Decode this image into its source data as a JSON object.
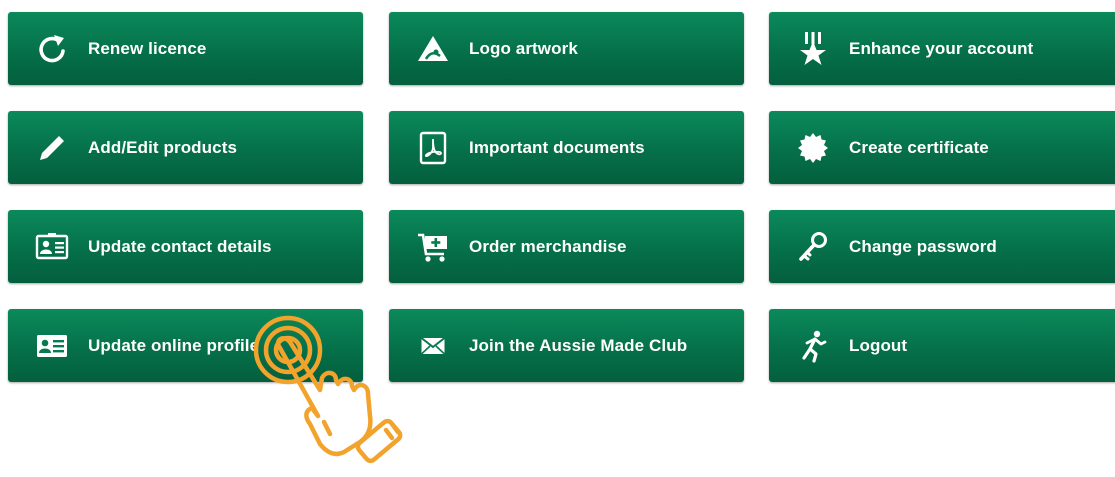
{
  "tiles": [
    {
      "label": "Renew licence",
      "icon": "refresh-icon"
    },
    {
      "label": "Logo artwork",
      "icon": "logo-mountain-icon"
    },
    {
      "label": "Enhance your account",
      "icon": "star-badge-icon"
    },
    {
      "label": "Add/Edit products",
      "icon": "pencil-icon"
    },
    {
      "label": "Important documents",
      "icon": "pdf-document-icon"
    },
    {
      "label": "Create certificate",
      "icon": "seal-icon"
    },
    {
      "label": "Update contact details",
      "icon": "contact-card-icon"
    },
    {
      "label": "Order merchandise",
      "icon": "cart-add-icon"
    },
    {
      "label": "Change password",
      "icon": "key-icon"
    },
    {
      "label": "Update online profile",
      "icon": "profile-card-icon"
    },
    {
      "label": "Join the Aussie Made Club",
      "icon": "envelope-icon"
    },
    {
      "label": "Logout",
      "icon": "running-man-icon"
    }
  ],
  "colors": {
    "tile": "#05704a",
    "tile_text": "#ffffff",
    "pointer": "#f2a32c"
  }
}
